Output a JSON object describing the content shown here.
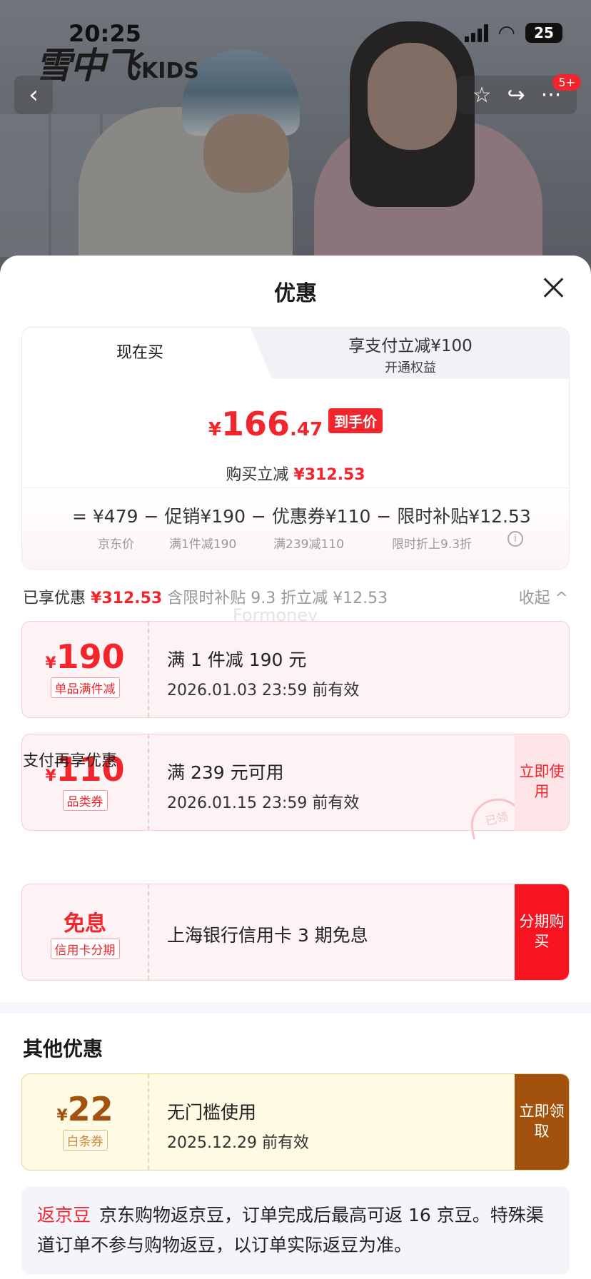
{
  "status": {
    "time": "20:25",
    "battery": "25"
  },
  "header": {
    "logo": "雪中飞",
    "logo_suffix": "KIDS",
    "badge": "5+"
  },
  "sheet": {
    "title": "优惠",
    "tabs": {
      "now": "现在买",
      "pay_line1": "享支付立减¥100",
      "pay_line2": "开通权益"
    },
    "price": {
      "yen": "¥",
      "int": "166",
      "dec": ".47",
      "tag": "到手价"
    },
    "reduce": {
      "label": "购买立减",
      "value": "¥312.53"
    },
    "breakdown": {
      "row": "=  ¥479  −  促销¥190  −  优惠券¥110  −  限时补贴¥12.53",
      "sub_jd": "京东价",
      "sub_promo": "满1件减190",
      "sub_coupon": "满239减110",
      "sub_subsidy": "限时折上9.3折"
    },
    "enjoyed": {
      "label": "已享优惠",
      "value": "¥312.53",
      "note": "含限时补贴 9.3 折立减 ¥12.53",
      "collapse": "收起 ^"
    },
    "coupons": [
      {
        "yen": "¥",
        "amount": "190",
        "label": "单品满件减",
        "title": "满 1 件减 190 元",
        "valid": "2026.01.03 23:59 前有效"
      },
      {
        "yen": "¥",
        "amount": "110",
        "label": "品类券",
        "title": "满 239 元可用",
        "valid": "2026.01.15 23:59 前有效",
        "action": "立即使用",
        "stamp": "已领"
      }
    ],
    "pay_title": "支付再享优惠",
    "pay_offer": {
      "amount": "免息",
      "label": "信用卡分期",
      "title": "上海银行信用卡 3 期免息",
      "action": "分期购买"
    },
    "other_title": "其他优惠",
    "other_coupon": {
      "yen": "¥",
      "amount": "22",
      "label": "白条券",
      "title": "无门槛使用",
      "valid": "2025.12.29 前有效",
      "action": "立即领取"
    },
    "bean": {
      "highlight": "返京豆",
      "text": "京东购物返京豆，订单完成后最高可返 16 京豆。特殊渠道订单不参与购物返豆，以订单实际返豆为准。"
    }
  },
  "watermark": "Formoney",
  "colors": {
    "accent": "#f2252d",
    "brown": "#a2520c"
  }
}
